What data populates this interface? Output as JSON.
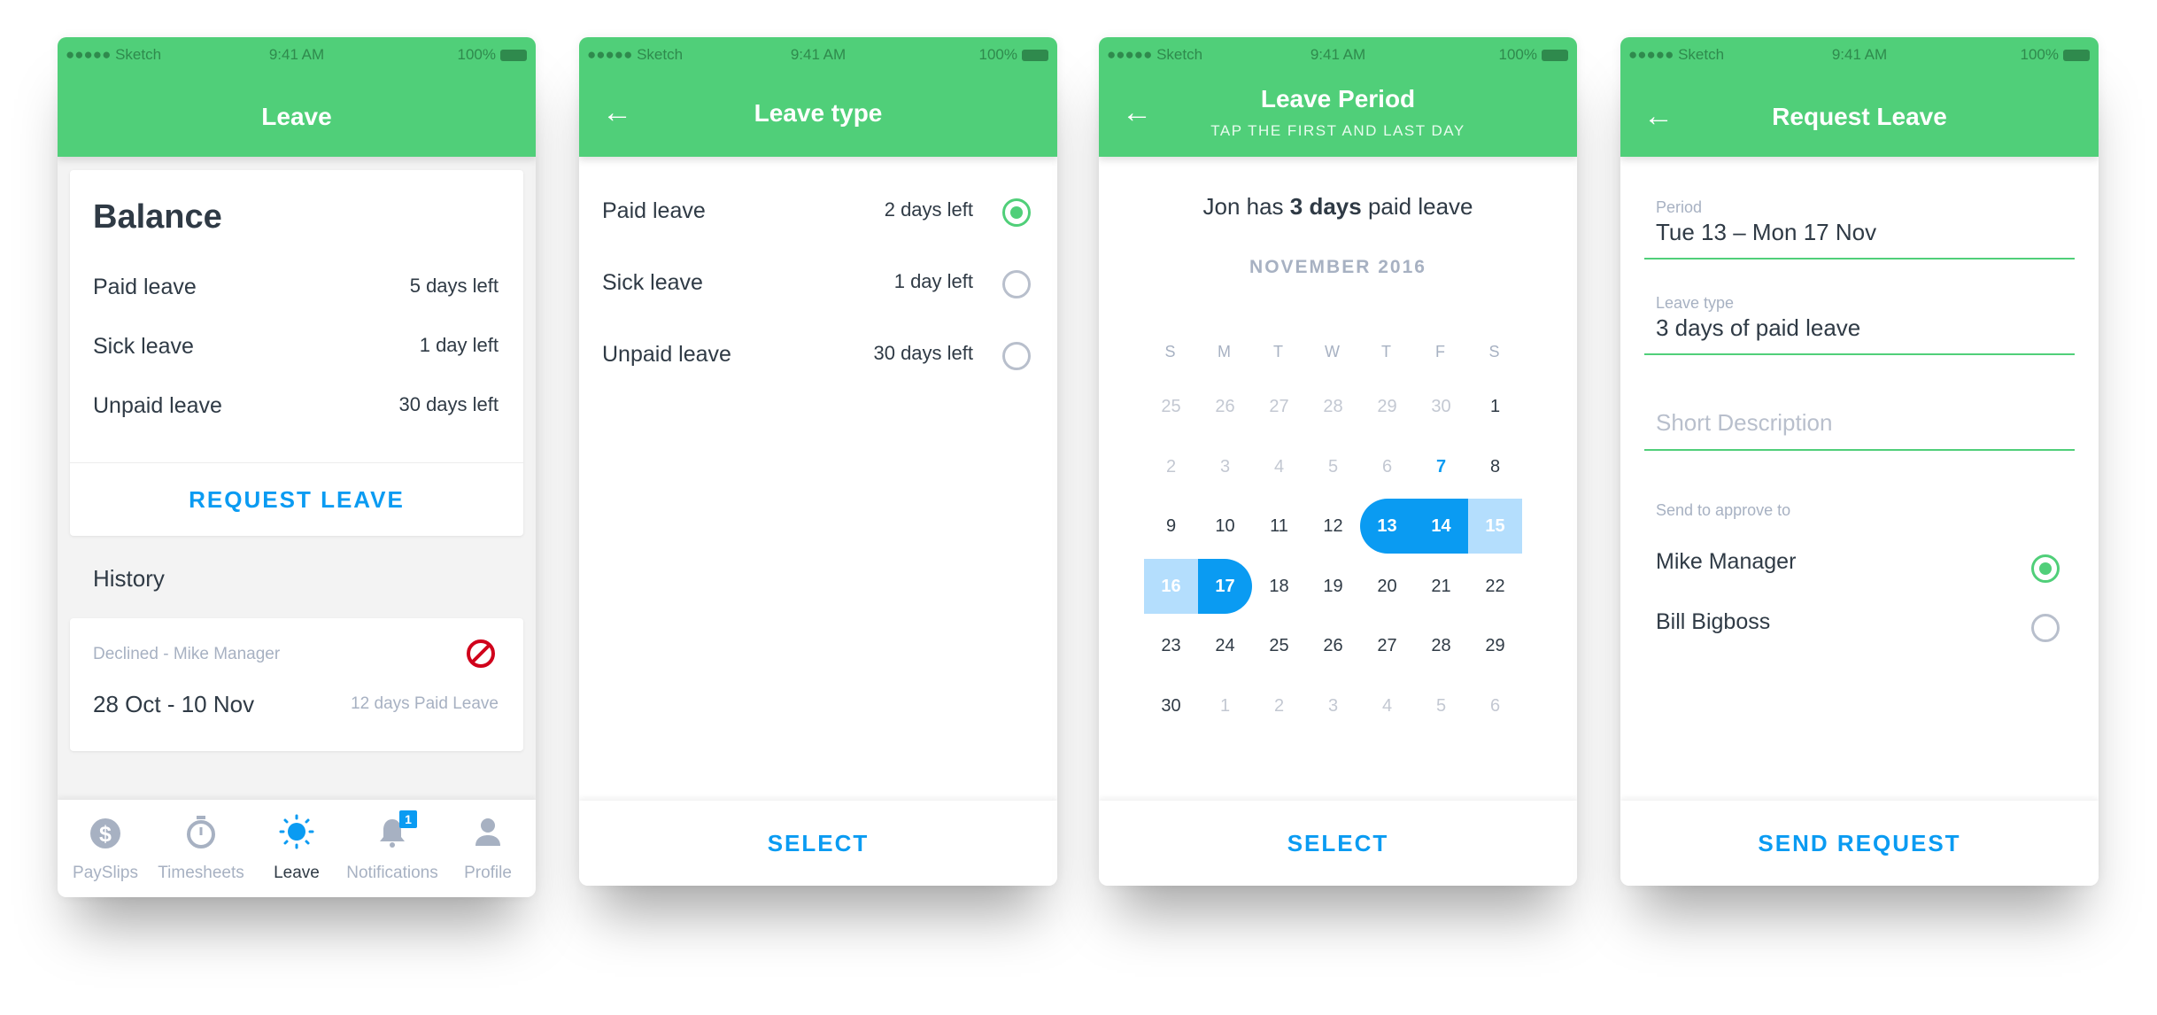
{
  "status_bar": {
    "carrier": "●●●●● Sketch",
    "time": "9:41 AM",
    "battery": "100%"
  },
  "screens": {
    "leave": {
      "title": "Leave",
      "balance": {
        "title": "Balance",
        "rows": [
          {
            "label": "Paid leave",
            "value": "5 days left"
          },
          {
            "label": "Sick leave",
            "value": "1 day left"
          },
          {
            "label": "Unpaid leave",
            "value": "30 days left"
          }
        ],
        "action": "REQUEST LEAVE"
      },
      "history": {
        "title": "History",
        "item": {
          "status": "Declined - Mike Manager",
          "dates": "28 Oct - 10 Nov",
          "summary": "12 days Paid Leave",
          "icon": "declined-icon"
        }
      },
      "tabbar": [
        {
          "label": "PaySlips",
          "icon": "dollar-icon"
        },
        {
          "label": "Timesheets",
          "icon": "stopwatch-icon"
        },
        {
          "label": "Leave",
          "icon": "sun-icon",
          "active": true
        },
        {
          "label": "Notifications",
          "icon": "bell-icon",
          "badge": "1"
        },
        {
          "label": "Profile",
          "icon": "person-icon"
        }
      ]
    },
    "leave_type": {
      "title": "Leave type",
      "options": [
        {
          "label": "Paid leave",
          "value": "2 days left",
          "selected": true
        },
        {
          "label": "Sick leave",
          "value": "1 day left",
          "selected": false
        },
        {
          "label": "Unpaid leave",
          "value": "30 days left",
          "selected": false
        }
      ],
      "action": "SELECT"
    },
    "leave_period": {
      "title": "Leave Period",
      "subtitle": "TAP THE FIRST AND LAST DAY",
      "summary_prefix": "Jon has ",
      "summary_bold": "3 days",
      "summary_suffix": " paid leave",
      "month": "NOVEMBER 2016",
      "weekdays": [
        "S",
        "M",
        "T",
        "W",
        "T",
        "F",
        "S"
      ],
      "weeks": [
        [
          "25",
          "26",
          "27",
          "28",
          "29",
          "30",
          "1"
        ],
        [
          "2",
          "3",
          "4",
          "5",
          "6",
          "7",
          "8"
        ],
        [
          "9",
          "10",
          "11",
          "12",
          "13",
          "14",
          "15"
        ],
        [
          "16",
          "17",
          "18",
          "19",
          "20",
          "21",
          "22"
        ],
        [
          "23",
          "24",
          "25",
          "26",
          "27",
          "28",
          "29"
        ],
        [
          "30",
          "1",
          "2",
          "3",
          "4",
          "5",
          "6"
        ]
      ],
      "today": "7",
      "selected_range": "13 – 17",
      "action": "SELECT"
    },
    "request_leave": {
      "title": "Request Leave",
      "period_label": "Period",
      "period_value": "Tue 13 – Mon 17 Nov",
      "type_label": "Leave type",
      "type_value": "3 days of paid leave",
      "description_placeholder": "Short Description",
      "approver_label": "Send to approve to",
      "approvers": [
        {
          "name": "Mike Manager",
          "selected": true
        },
        {
          "name": "Bill Bigboss",
          "selected": false
        }
      ],
      "action": "SEND REQUEST"
    }
  },
  "colors": {
    "brand_green": "#50cf79",
    "accent_blue": "#0a9bf2",
    "range_light": "#b4defd",
    "declined_red": "#d0021b"
  }
}
